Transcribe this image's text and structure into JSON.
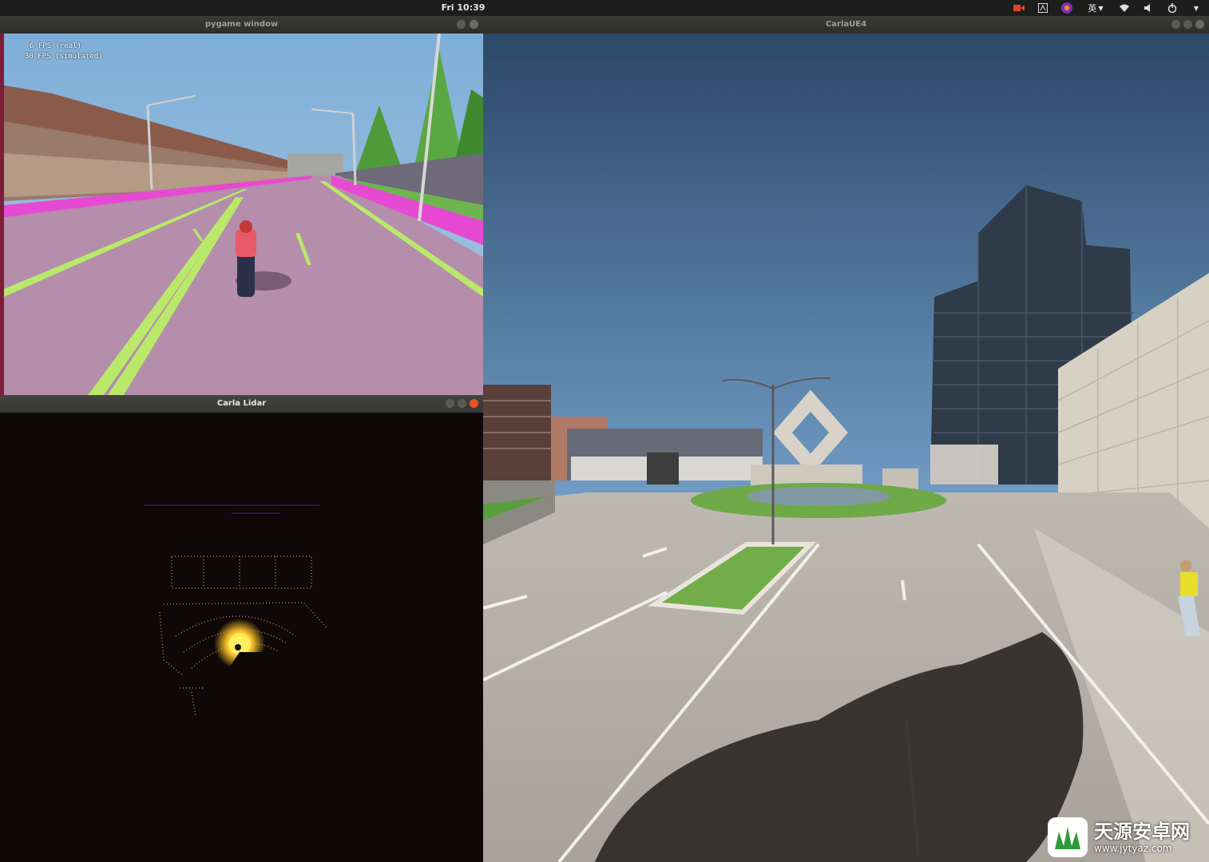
{
  "topbar": {
    "clock": "Fri 10:39",
    "input_method": "英",
    "icons": [
      "record-icon",
      "accessibility-icon",
      "app-indicator-icon",
      "wifi-icon",
      "volume-icon",
      "power-icon",
      "chevron-down-icon"
    ]
  },
  "windows": {
    "pygame": {
      "title": "pygame window",
      "hud": {
        "fps_real": "6 FPS (real)",
        "fps_sim": "30 FPS (simulated)"
      }
    },
    "lidar": {
      "title": "Carla Lidar"
    },
    "carla": {
      "title": "CarlaUE4"
    }
  },
  "watermark": {
    "text": "天源安卓网",
    "url": "www.jytyaz.com"
  },
  "colors": {
    "accent": "#e95420",
    "road_segmentation": "#b48eaa",
    "sidewalk_segmentation": "#e64ad2",
    "lane_marking": "#b9e86a"
  }
}
